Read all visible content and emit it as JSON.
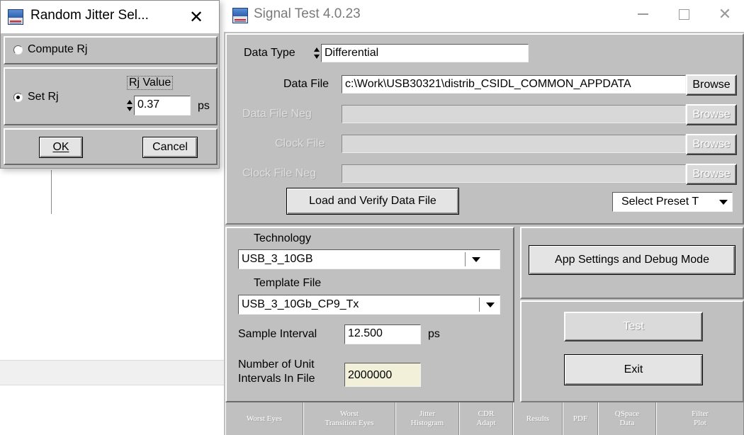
{
  "dialog": {
    "title": "Random Jitter Sel...",
    "close_glyph": "✕",
    "compute_label": "Compute Rj",
    "set_label": "Set Rj",
    "rj_value_label": "Rj Value",
    "rj_value": "0.37",
    "rj_unit": "ps",
    "ok_label": "OK",
    "cancel_label": "Cancel",
    "selected_option": "Set Rj"
  },
  "window": {
    "title": "Signal Test 4.0.23",
    "minimize": "minimize",
    "maximize": "maximize",
    "close_glyph": "✕"
  },
  "data_section": {
    "data_type_label": "Data Type",
    "data_type_value": "Differential",
    "data_file_label": "Data File",
    "data_file_value": "c:\\Work\\USB30321\\distrib_CSIDL_COMMON_APPDATA",
    "data_file_neg_label": "Data File Neg",
    "clock_file_label": "Clock File",
    "clock_file_neg_label": "Clock File Neg",
    "browse_label": "Browse",
    "load_button": "Load and Verify Data File",
    "preset_select": "Select Preset T"
  },
  "config": {
    "technology_label": "Technology",
    "technology_value": "USB_3_10GB",
    "template_label": "Template File",
    "template_value": "USB_3_10Gb_CP9_Tx",
    "sample_interval_label": "Sample Interval",
    "sample_interval_value": "12.500",
    "sample_interval_unit": "ps",
    "ui_count_label_1": "Number of Unit",
    "ui_count_label_2": "Intervals In File",
    "ui_count_value": "2000000"
  },
  "actions": {
    "app_settings": "App Settings and Debug Mode",
    "test": "Test",
    "exit": "Exit"
  },
  "tabs": [
    {
      "l1": "Worst Eyes",
      "l2": ""
    },
    {
      "l1": "Worst",
      "l2": "Transition Eyes"
    },
    {
      "l1": "Jitter",
      "l2": "Histogram"
    },
    {
      "l1": "CDR",
      "l2": "Adapt"
    },
    {
      "l1": "Results",
      "l2": ""
    },
    {
      "l1": "PDF",
      "l2": ""
    },
    {
      "l1": "QSpace",
      "l2": "Data"
    },
    {
      "l1": "Filter",
      "l2": "Plot"
    }
  ],
  "colors": {
    "window_bg": "#c0c0c0",
    "field_bg": "#ffffff",
    "readonly_bg": "#f2f0d9",
    "disabled_text": "#ffffff"
  }
}
